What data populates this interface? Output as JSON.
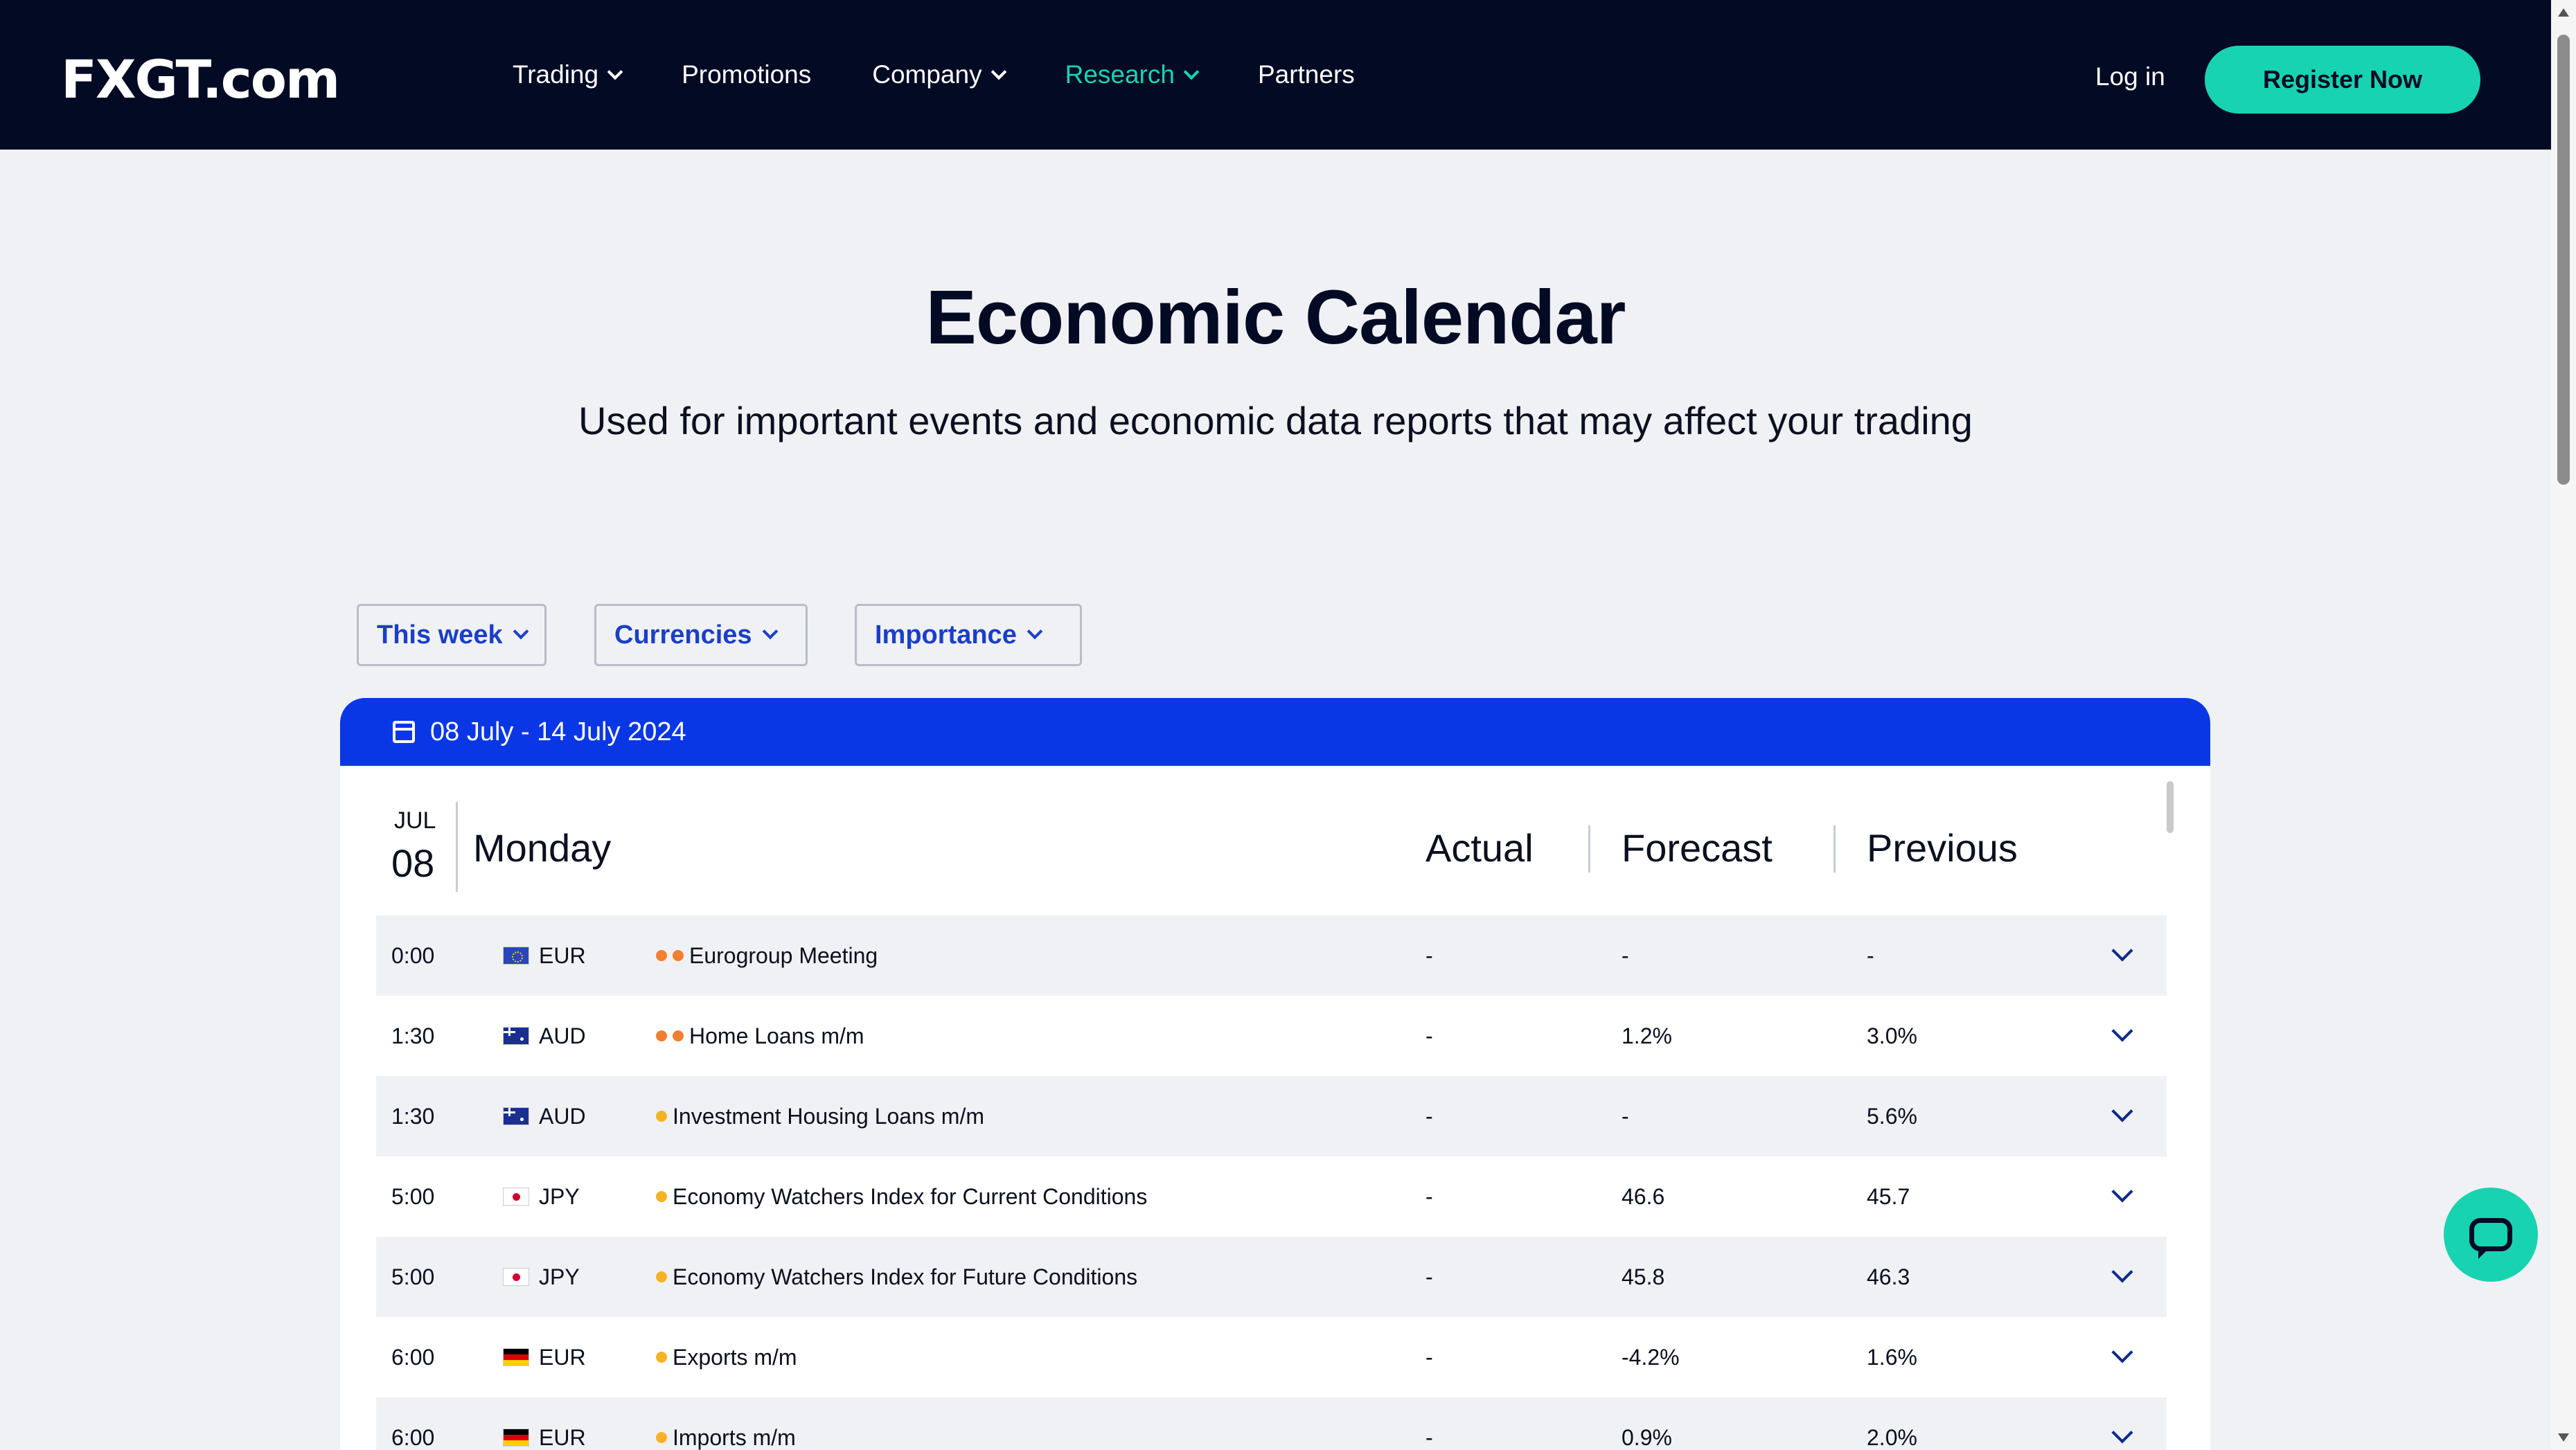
{
  "header": {
    "logo": "FXGT.com",
    "nav": [
      {
        "label": "Trading",
        "has_dropdown": true,
        "active": false
      },
      {
        "label": "Promotions",
        "has_dropdown": false,
        "active": false
      },
      {
        "label": "Company",
        "has_dropdown": true,
        "active": false
      },
      {
        "label": "Research",
        "has_dropdown": true,
        "active": true
      },
      {
        "label": "Partners",
        "has_dropdown": false,
        "active": false
      }
    ],
    "login": "Log in",
    "register": "Register Now"
  },
  "hero": {
    "title": "Economic Calendar",
    "subtitle": "Used for important events and economic data reports that may affect your trading"
  },
  "filters": {
    "period": "This week",
    "currencies": "Currencies",
    "importance": "Importance"
  },
  "calendar": {
    "range": "08 July - 14 July 2024",
    "day": {
      "month": "JUL",
      "date": "08",
      "name": "Monday"
    },
    "columns": {
      "actual": "Actual",
      "forecast": "Forecast",
      "previous": "Previous"
    },
    "rows": [
      {
        "time": "0:00",
        "flag": "eu",
        "currency": "EUR",
        "importance": 2,
        "event": "Eurogroup Meeting",
        "actual": "-",
        "forecast": "-",
        "previous": "-"
      },
      {
        "time": "1:30",
        "flag": "au",
        "currency": "AUD",
        "importance": 2,
        "event": "Home Loans m/m",
        "actual": "-",
        "forecast": "1.2%",
        "previous": "3.0%"
      },
      {
        "time": "1:30",
        "flag": "au",
        "currency": "AUD",
        "importance": 1,
        "event": "Investment Housing Loans m/m",
        "actual": "-",
        "forecast": "-",
        "previous": "5.6%"
      },
      {
        "time": "5:00",
        "flag": "jp",
        "currency": "JPY",
        "importance": 1,
        "event": "Economy Watchers Index for Current Conditions",
        "actual": "-",
        "forecast": "46.6",
        "previous": "45.7"
      },
      {
        "time": "5:00",
        "flag": "jp",
        "currency": "JPY",
        "importance": 1,
        "event": "Economy Watchers Index for Future Conditions",
        "actual": "-",
        "forecast": "45.8",
        "previous": "46.3"
      },
      {
        "time": "6:00",
        "flag": "de",
        "currency": "EUR",
        "importance": 1,
        "event": "Exports m/m",
        "actual": "-",
        "forecast": "-4.2%",
        "previous": "1.6%"
      },
      {
        "time": "6:00",
        "flag": "de",
        "currency": "EUR",
        "importance": 1,
        "event": "Imports m/m",
        "actual": "-",
        "forecast": "0.9%",
        "previous": "2.0%"
      }
    ]
  },
  "colors": {
    "nav_bg": "#030a24",
    "accent": "#18d3b1",
    "calendar_bar": "#0a37e6",
    "filter_text": "#1b3fc9",
    "importance_medium": "#f07f2f",
    "importance_low": "#f5b324"
  },
  "icons": {
    "calendar": "calendar-icon",
    "row_expand": "chevron-down-icon",
    "chat": "chat-bubble-icon"
  }
}
